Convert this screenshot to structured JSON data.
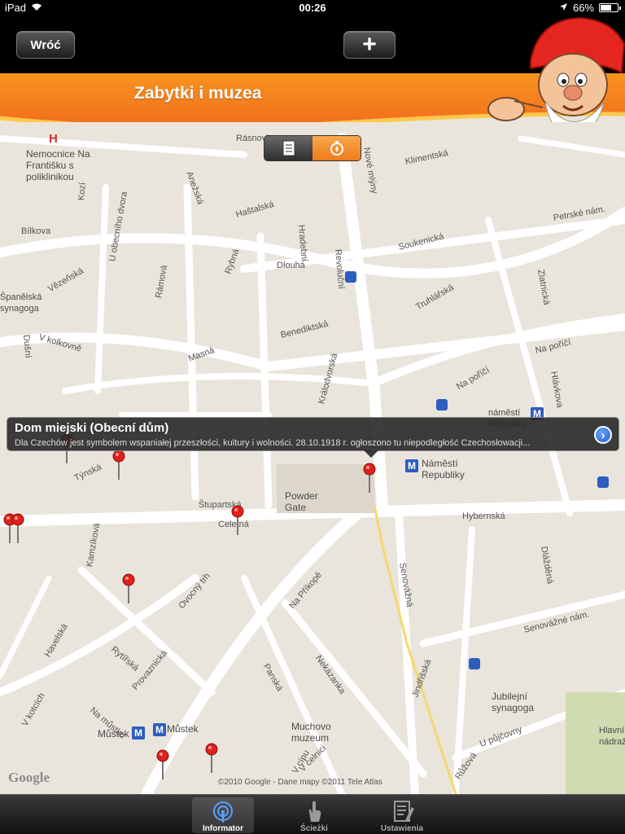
{
  "status_bar": {
    "device": "iPad",
    "time": "00:26",
    "battery": "66%",
    "battery_level": 0.66
  },
  "nav": {
    "back_label": "Wróć",
    "add_label": "+"
  },
  "header": {
    "title": "Zabytki i muzea"
  },
  "segmented_control": {
    "items": [
      "list-icon",
      "map-icon"
    ],
    "selected": "map-icon"
  },
  "map": {
    "streets": [
      "Klimentská",
      "Bílkova",
      "Haštalská",
      "Dlouhá",
      "Rybná",
      "Hradební",
      "Revoluční",
      "Soukenická",
      "Petrské nám.",
      "Truhlářská",
      "Zlatnická",
      "Na poříčí",
      "Benediktská",
      "Masná",
      "Dušní",
      "Vězeňská",
      "V kolkovně",
      "Kozí",
      "Anežská",
      "U obecního dvora",
      "Rámová",
      "Týnská",
      "Štupartská",
      "Celetná",
      "Hybernská",
      "Na Příkopě",
      "Senovážná",
      "Dlážděná",
      "Senovážné nám.",
      "Nekázanka",
      "Panská",
      "Jindřišská",
      "V celnici",
      "Havelská",
      "Rytířská",
      "Provaznická",
      "Na můstku",
      "V kotcích",
      "Kamzíková",
      "Ovocný trh",
      "Králodvorská",
      "Nové mlýny",
      "Rásnovka",
      "V cípu",
      "Růžová",
      "U půjčovny",
      "Na poříčí",
      "Hlávkova"
    ],
    "pois": {
      "hospital": "Nemocnice Na Františku s poliklinikou",
      "synagogue_left": "Španělská synagoga",
      "metro_republiky": "Náměstí Republiky",
      "metro_republiky_small": "náměstí Republiky",
      "powder_gate": "Powder Gate",
      "metro_mustek": "Můstek",
      "museum": "Muchovo muzeum",
      "synagogue_right": "Jubilejní synagoga",
      "station_right": "Hlavní nádraží"
    },
    "google_logo": "Google",
    "copyright": "©2010 Google - Dane mapy ©2011 Tele Atlas"
  },
  "callout": {
    "title": "Dom miejski (Obecní dům)",
    "description": "Dla Czechów jest symbolem wspaniałej przeszłości, kultury i wolności.  28.10.1918  r. ogłoszono tu niepodległość Czechosłowacji..."
  },
  "tabs": [
    {
      "label": "Informator",
      "icon": "informator-icon",
      "active": true
    },
    {
      "label": "Ścieżki",
      "icon": "hand-icon",
      "active": false
    },
    {
      "label": "Ustawienia",
      "icon": "settings-icon",
      "active": false
    }
  ]
}
